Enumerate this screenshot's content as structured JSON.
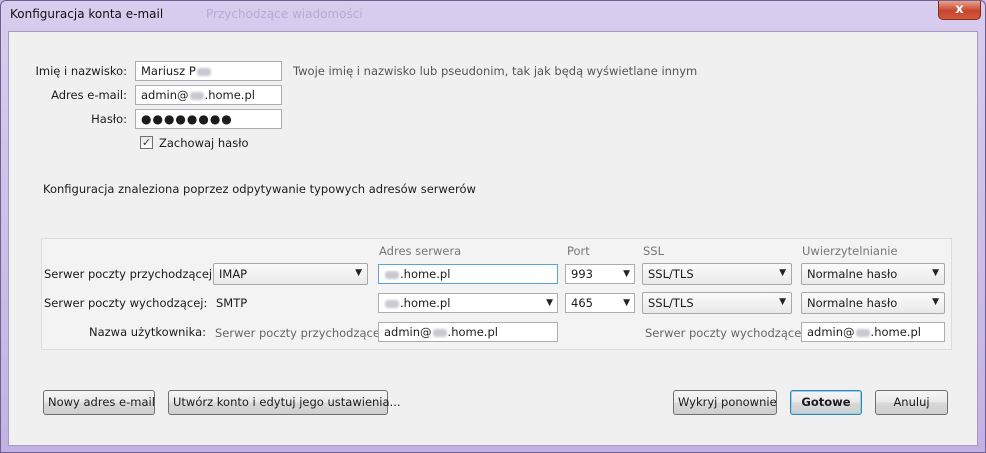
{
  "window": {
    "title": "Konfiguracja konta e-mail",
    "background_title": "Przychodzące wiadomości",
    "close_glyph": "x"
  },
  "identity": {
    "name_label": "Imię i nazwisko:",
    "name_value": "Mariusz P",
    "name_hint": "Twoje imię i nazwisko lub pseudonim, tak jak będą wyświetlane innym",
    "email_label": "Adres e-mail:",
    "email_prefix": "admin@",
    "email_suffix": ".home.pl",
    "password_label": "Hasło:",
    "password_mask": "●●●●●●●●",
    "remember_label": "Zachowaj hasło",
    "remember_checked": true
  },
  "status_text": "Konfiguracja znaleziona poprzez odpytywanie typowych adresów serwerów",
  "servers": {
    "columns": {
      "address": "Adres serwera",
      "port": "Port",
      "ssl": "SSL",
      "auth": "Uwierzytelnianie"
    },
    "incoming": {
      "label": "Serwer poczty przychodzącej:",
      "protocol": "IMAP",
      "host_suffix": ".home.pl",
      "port": "993",
      "ssl": "SSL/TLS",
      "auth": "Normalne hasło"
    },
    "outgoing": {
      "label": "Serwer poczty wychodzącej:",
      "protocol": "SMTP",
      "host_suffix": ".home.pl",
      "port": "465",
      "ssl": "SSL/TLS",
      "auth": "Normalne hasło"
    },
    "username": {
      "label": "Nazwa użytkownika:",
      "incoming_label": "Serwer poczty przychodzącej:",
      "incoming_prefix": "admin@",
      "incoming_suffix": ".home.pl",
      "outgoing_label": "Serwer poczty wychodzącej:",
      "outgoing_prefix": "admin@",
      "outgoing_suffix": ".home.pl"
    }
  },
  "buttons": {
    "new_email": "Nowy adres e-mail",
    "create_edit": "Utwórz konto i edytuj jego ustawienia...",
    "redetect": "Wykryj ponownie",
    "done": "Gotowe",
    "cancel": "Anuluj"
  },
  "icons": {
    "dropdown": "▼",
    "check": "✓"
  }
}
